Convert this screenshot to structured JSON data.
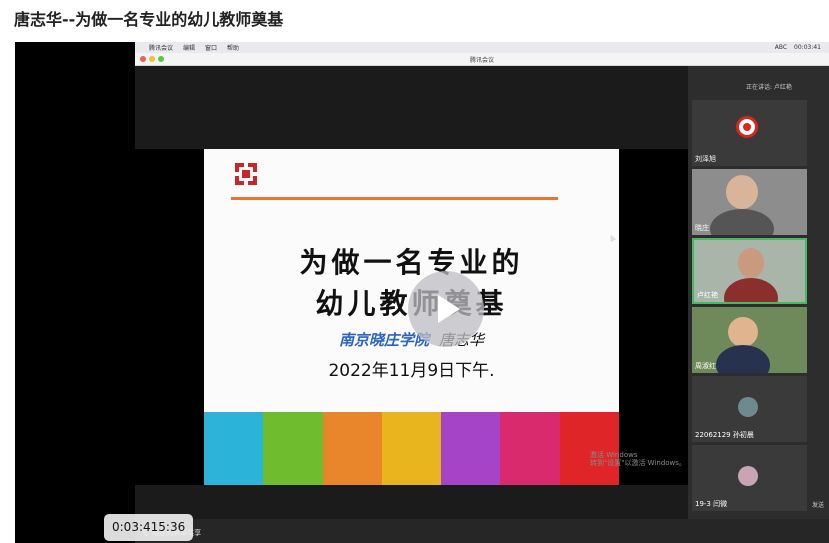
{
  "page_title": "唐志华--为做一名专业的幼儿教师奠基",
  "menubar": {
    "app": "腾讯会议",
    "items": [
      "编辑",
      "窗口",
      "帮助"
    ],
    "clock": "00:03:41",
    "status_text": "ABC"
  },
  "window_title": "腾讯会议",
  "slide": {
    "title_line1": "为做一名专业的",
    "title_line2": "幼儿教师奠基",
    "school": "南京晓庄学院",
    "author": "唐志华",
    "date": "2022年11月9日下午.",
    "stripe_colors": [
      "#2bb3d9",
      "#6fbd2f",
      "#e9852b",
      "#e9b51f",
      "#a544c6",
      "#d92a6e",
      "#e02528"
    ]
  },
  "watermark": {
    "line1": "激活 Windows",
    "line2": "转到\"设置\"以激活 Windows。"
  },
  "sharer": "晓庄的屏幕共享",
  "playback_time": "0:03:41",
  "playback_time_suffix": "5:36",
  "participants_panel": {
    "speaking_label": "正在讲话: 卢红艳",
    "participants": [
      {
        "name": "刘泽旭"
      },
      {
        "name": "晓庄"
      },
      {
        "name": "卢红艳"
      },
      {
        "name": "周淑红"
      },
      {
        "name": "22062129 孙初晨"
      },
      {
        "name": "19-3 闫微"
      }
    ],
    "side_text": "发送"
  },
  "colors": {
    "accent_orange": "#e8762e",
    "school_blue": "#2a62c8",
    "active_speaker": "#3cbf5c"
  },
  "icons": {
    "play": "play-icon",
    "mic": "mic-icon",
    "apple": "apple-icon"
  }
}
